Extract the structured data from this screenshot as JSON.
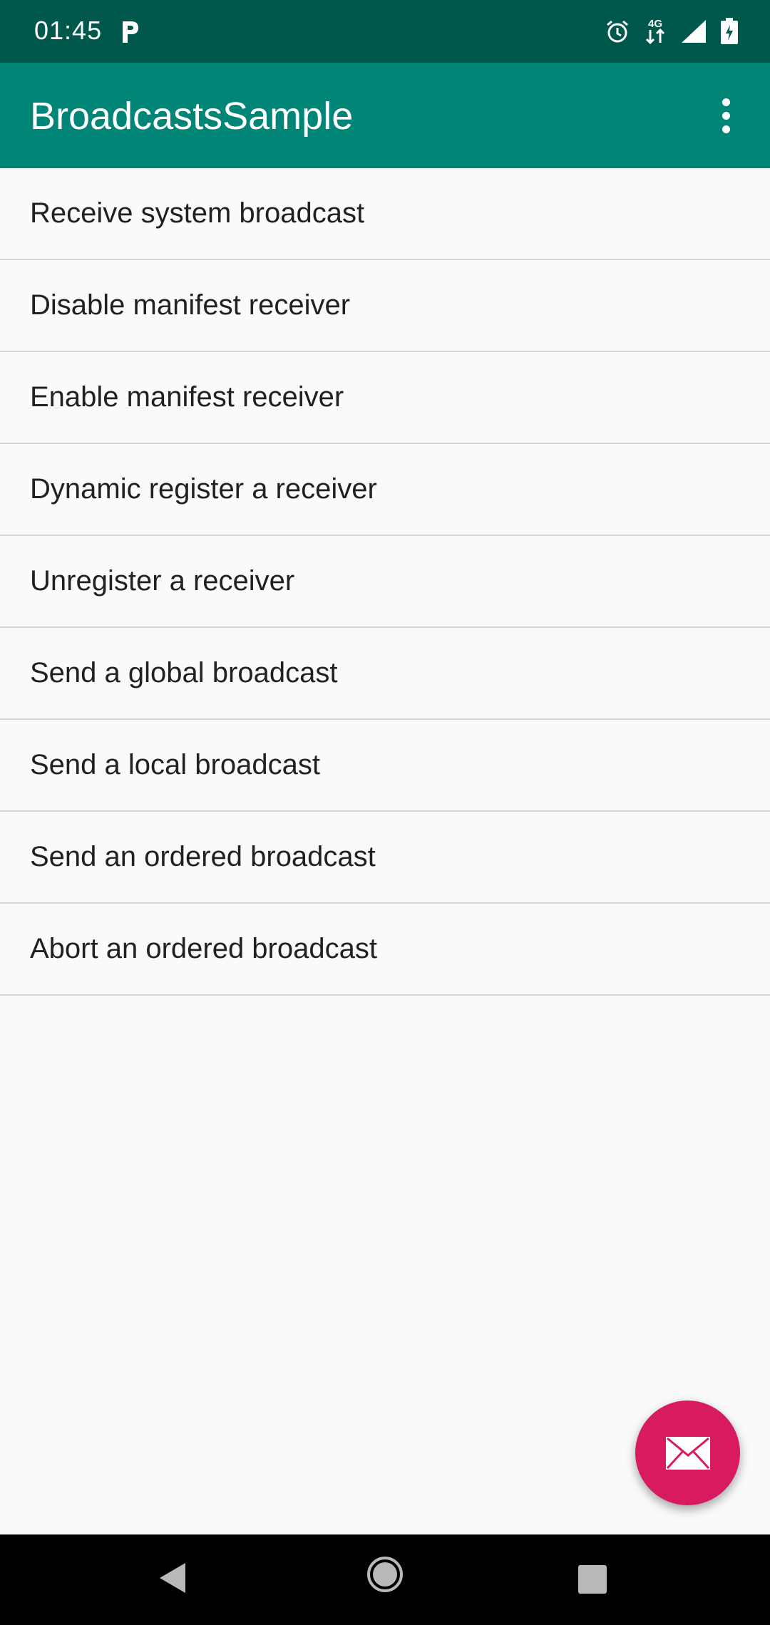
{
  "status_bar": {
    "time": "01:45",
    "network_label": "4G",
    "icons": [
      "parking-icon",
      "alarm-icon",
      "network-4g-icon",
      "signal-icon",
      "battery-icon"
    ]
  },
  "app_bar": {
    "title": "BroadcastsSample",
    "overflow_icon": "more-vert-icon"
  },
  "list": {
    "items": [
      {
        "label": "Receive system broadcast"
      },
      {
        "label": "Disable manifest receiver"
      },
      {
        "label": "Enable manifest receiver"
      },
      {
        "label": "Dynamic register a receiver"
      },
      {
        "label": "Unregister a receiver"
      },
      {
        "label": "Send a global broadcast"
      },
      {
        "label": "Send a local broadcast"
      },
      {
        "label": "Send an ordered broadcast"
      },
      {
        "label": "Abort an ordered broadcast"
      }
    ]
  },
  "fab": {
    "icon": "mail-icon"
  },
  "nav_bar": {
    "icons": [
      "back-icon",
      "home-icon",
      "recents-icon"
    ]
  },
  "colors": {
    "status_bar": "#00574b",
    "primary": "#008577",
    "accent": "#d81b60",
    "background": "#fafafa"
  }
}
